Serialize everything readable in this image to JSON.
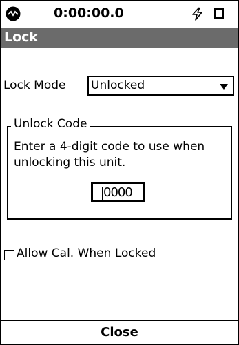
{
  "status_bar": {
    "timer": "0:00:00.0",
    "logo_icon": "device-logo-icon",
    "power_icon": "lightning-icon",
    "battery_icon": "battery-icon"
  },
  "window": {
    "title": "Lock"
  },
  "lock_mode": {
    "label": "Lock Mode",
    "selected": "Unlocked"
  },
  "unlock_code": {
    "group_label": "Unlock Code",
    "description": "Enter a 4-digit code to use when unlocking this unit.",
    "value": "0000"
  },
  "allow_cal": {
    "label": "Allow Cal. When Locked",
    "checked": false
  },
  "footer": {
    "close_label": "Close"
  }
}
